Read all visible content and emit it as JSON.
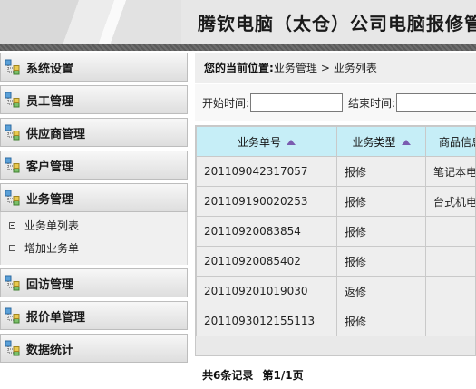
{
  "app": {
    "title": "腾钦电脑（太仓）公司电脑报修管理系统"
  },
  "sidebar": {
    "groups": [
      {
        "label": "系统设置",
        "icon": "tree-node-icon"
      },
      {
        "label": "员工管理",
        "icon": "tree-node-icon"
      },
      {
        "label": "供应商管理",
        "icon": "tree-node-icon"
      },
      {
        "label": "客户管理",
        "icon": "tree-node-icon"
      },
      {
        "label": "业务管理",
        "icon": "tree-node-icon",
        "expanded": true,
        "items": [
          {
            "label": "业务单列表",
            "icon": "leaf-box-icon"
          },
          {
            "label": "增加业务单",
            "icon": "leaf-box-icon"
          }
        ]
      },
      {
        "label": "回访管理",
        "icon": "tree-node-icon"
      },
      {
        "label": "报价单管理",
        "icon": "tree-node-icon"
      },
      {
        "label": "数据统计",
        "icon": "tree-node-icon"
      }
    ]
  },
  "breadcrumb": {
    "label": "您的当前位置:",
    "path": [
      "业务管理",
      "业务列表"
    ],
    "separator": ">"
  },
  "filter": {
    "start_label": "开始时间:",
    "start_value": "",
    "end_label": "结束时间:",
    "end_value": ""
  },
  "table": {
    "columns": [
      "业务单号",
      "业务类型",
      "商品信息"
    ],
    "rows": [
      [
        "201109042317057",
        "报修",
        "笔记本电脑"
      ],
      [
        "201109190020253",
        "报修",
        "台式机电脑"
      ],
      [
        "20110920083854",
        "报修",
        ""
      ],
      [
        "20110920085402",
        "报修",
        ""
      ],
      [
        "201109201019030",
        "返修",
        ""
      ],
      [
        "2011093012155113",
        "报修",
        ""
      ]
    ]
  },
  "pagination": {
    "summary": "共6条记录",
    "page": "第1/1页"
  },
  "colors": {
    "header_bg": "#e7e7e7",
    "table_header_bg": "#c6eef7",
    "sort_arrow": "#7a5cb0"
  }
}
